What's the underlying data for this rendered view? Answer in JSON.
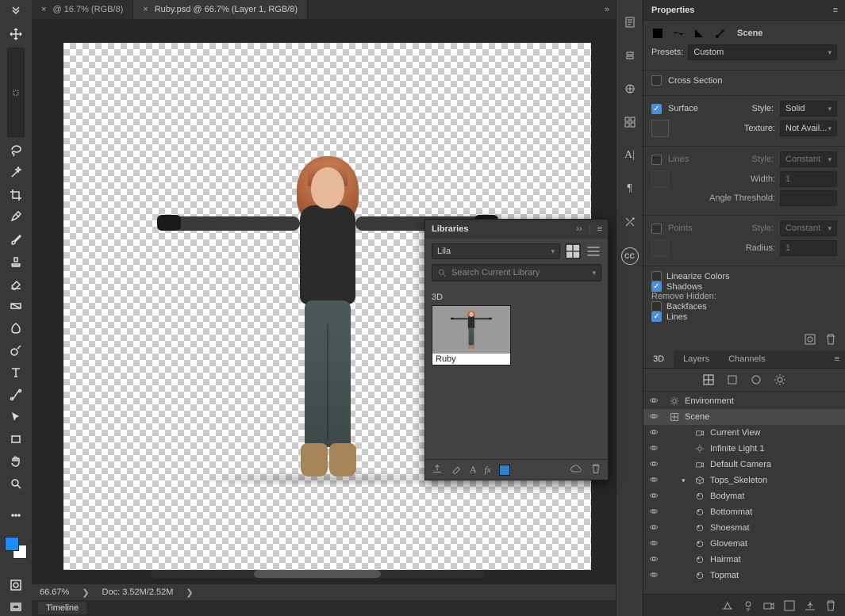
{
  "tabs": [
    {
      "label": "@ 16.7% (RGB/8)",
      "active": false
    },
    {
      "label": "Ruby.psd @ 66.7% (Layer 1, RGB/8)",
      "active": true
    }
  ],
  "status": {
    "zoom": "66.67%",
    "doc": "Doc: 3.52M/2.52M"
  },
  "timeline": {
    "title": "Timeline"
  },
  "tools": [
    "move",
    "marquee",
    "lasso",
    "magic-wand",
    "crop",
    "eyedropper",
    "brush",
    "stamp",
    "eraser",
    "gradient",
    "smudge",
    "dodge",
    "type",
    "path",
    "arrow",
    "rectangle",
    "hand",
    "zoom"
  ],
  "libraries": {
    "title": "Libraries",
    "library_name": "Lila",
    "search_placeholder": "Search Current Library",
    "group": "3D",
    "asset_name": "Ruby",
    "chip_color": "#2b7fd4"
  },
  "properties": {
    "title": "Properties",
    "scene_label": "Scene",
    "presets_label": "Presets:",
    "presets_value": "Custom",
    "cross_section": {
      "label": "Cross Section",
      "checked": false
    },
    "surface": {
      "label": "Surface",
      "checked": true,
      "style_label": "Style:",
      "style_value": "Solid",
      "texture_label": "Texture:",
      "texture_value": "Not Avail..."
    },
    "lines": {
      "label": "Lines",
      "checked": false,
      "style_label": "Style:",
      "style_value": "Constant",
      "width_label": "Width:",
      "width_value": "1",
      "angle_label": "Angle Threshold:"
    },
    "points": {
      "label": "Points",
      "checked": false,
      "style_label": "Style:",
      "style_value": "Constant",
      "radius_label": "Radius:",
      "radius_value": "1"
    },
    "linearize": {
      "label": "Linearize Colors",
      "checked": false
    },
    "shadows": {
      "label": "Shadows",
      "checked": true
    },
    "remove_hidden": "Remove Hidden:",
    "backfaces": {
      "label": "Backfaces",
      "checked": false
    },
    "lines2": {
      "label": "Lines",
      "checked": true
    }
  },
  "scene_panel": {
    "tabs": [
      "3D",
      "Layers",
      "Channels"
    ],
    "active_tab": "3D",
    "items": [
      {
        "name": "Environment",
        "icon": "environment",
        "indent": 0,
        "eye": true
      },
      {
        "name": "Scene",
        "icon": "scene",
        "indent": 0,
        "eye": true,
        "selected": true
      },
      {
        "name": "Current View",
        "icon": "camera",
        "indent": 1,
        "eye": true
      },
      {
        "name": "Infinite Light 1",
        "icon": "light",
        "indent": 1,
        "eye": true
      },
      {
        "name": "Default Camera",
        "icon": "camera",
        "indent": 1,
        "eye": true
      },
      {
        "name": "Tops_Skeleton",
        "icon": "mesh",
        "indent": 1,
        "eye": true,
        "caret": "open"
      },
      {
        "name": "Bodymat",
        "icon": "material",
        "indent": 2,
        "eye": true
      },
      {
        "name": "Bottommat",
        "icon": "material",
        "indent": 2,
        "eye": true
      },
      {
        "name": "Shoesmat",
        "icon": "material",
        "indent": 2,
        "eye": true
      },
      {
        "name": "Glovemat",
        "icon": "material",
        "indent": 2,
        "eye": true
      },
      {
        "name": "Hairmat",
        "icon": "material",
        "indent": 2,
        "eye": true
      },
      {
        "name": "Topmat",
        "icon": "material",
        "indent": 2,
        "eye": true
      }
    ]
  }
}
